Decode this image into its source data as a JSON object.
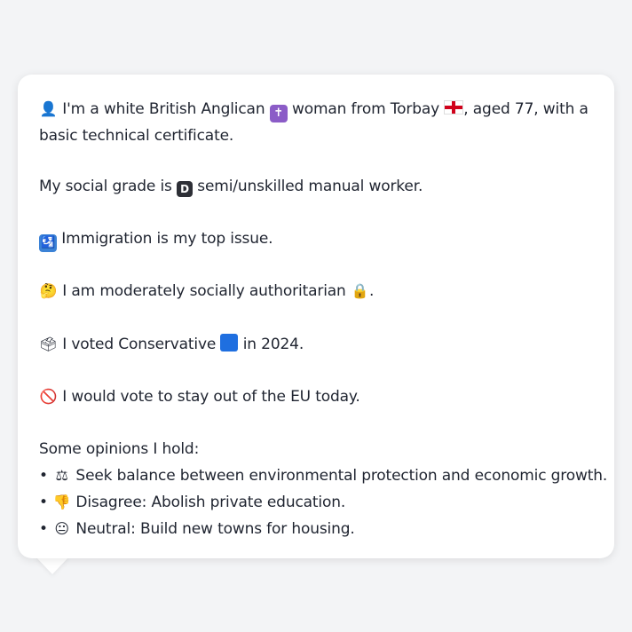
{
  "profile": {
    "intro_icon": "bust-in-silhouette-icon",
    "intro_a": "I'm a white British Anglican",
    "religion_icon": "latin-cross-icon",
    "intro_b": "woman from Torbay",
    "flag_icon": "england-flag-icon",
    "intro_c": ", aged 77, with a",
    "intro_d": "basic technical certificate.",
    "social_a": "My social grade is",
    "social_badge": "D",
    "social_b": "semi/unskilled manual worker.",
    "issue_icon": "passport-control-icon",
    "issue_text": "Immigration is my top issue.",
    "values_icon": "thinking-face-icon",
    "values_text": "I am moderately socially authoritarian",
    "lock_icon": "lock-icon",
    "values_end": ".",
    "vote_icon": "ballot-box-icon",
    "vote_a": "I voted Conservative",
    "party_icon": "blue-square-icon",
    "vote_b": "in 2024.",
    "eu_icon": "no-entry-icon",
    "eu_text": "I would vote to stay out of the EU today.",
    "opinions_heading": "Some opinions I hold:",
    "opinions": [
      {
        "bullet": "•",
        "icon": "balance-scale-icon",
        "text": "Seek balance between environmental protection and economic growth."
      },
      {
        "bullet": "•",
        "icon": "thumbs-down-icon",
        "text": "Disagree: Abolish private education."
      },
      {
        "bullet": "•",
        "icon": "neutral-face-icon",
        "text": "Neutral: Build new towns for housing."
      }
    ]
  }
}
